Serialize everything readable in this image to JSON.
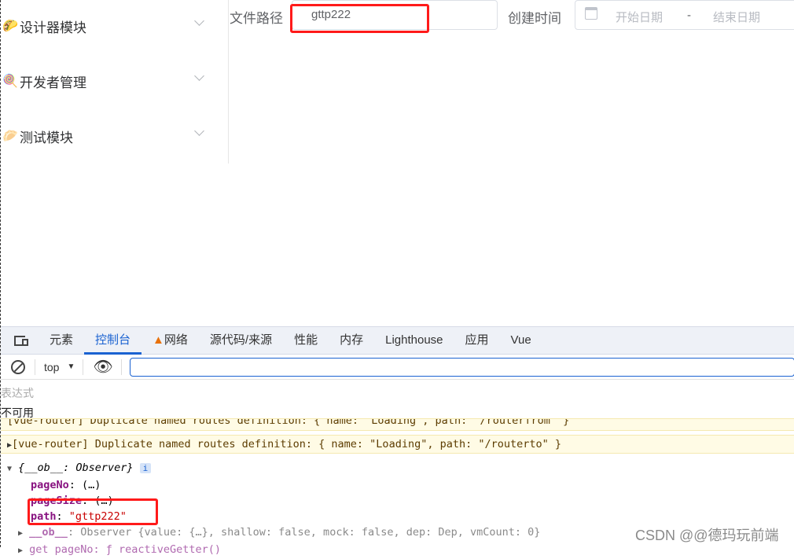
{
  "sidebar": {
    "items": [
      {
        "label": "设计器模块",
        "icon": "🌮"
      },
      {
        "label": "开发者管理",
        "icon": "🍭"
      },
      {
        "label": "测试模块",
        "icon": "🥟"
      }
    ]
  },
  "form": {
    "path_label": "文件路径",
    "path_value": "gttp222",
    "time_label": "创建时间",
    "start_placeholder": "开始日期",
    "separator": "-",
    "end_placeholder": "结束日期"
  },
  "devtools": {
    "tabs": [
      {
        "label": "元素"
      },
      {
        "label": "控制台",
        "active": true
      },
      {
        "label": "网络",
        "warning": true
      },
      {
        "label": "源代码/来源"
      },
      {
        "label": "性能"
      },
      {
        "label": "内存"
      },
      {
        "label": "Lighthouse"
      },
      {
        "label": "应用"
      },
      {
        "label": "Vue"
      }
    ],
    "context": "top",
    "expression_placeholder": "表达式",
    "expression_result": "不可用",
    "messages": [
      "[vue-router] Duplicate named routes definition: { name: \"Loading\", path: \"/routerfrom\" }",
      "[vue-router] Duplicate named routes definition: { name: \"Loading\", path: \"/routerto\" }"
    ],
    "object": {
      "summary": "{__ob__: Observer}",
      "info": "i",
      "props": [
        {
          "key": "pageNo",
          "value": "(…)"
        },
        {
          "key": "pageSize",
          "value": "(…)"
        },
        {
          "key": "path",
          "value": "\"gttp222\""
        }
      ],
      "ob_key": "__ob__",
      "ob_value": ": Observer {value: {…}, shallow: false, mock: false, dep: Dep, vmCount: 0}",
      "getter": "get pageNo: ƒ reactiveGetter()"
    }
  },
  "watermark": "CSDN @@德玛玩前端",
  "colors": {
    "highlight": "#ff1a1a",
    "accent": "#1a62d1"
  }
}
